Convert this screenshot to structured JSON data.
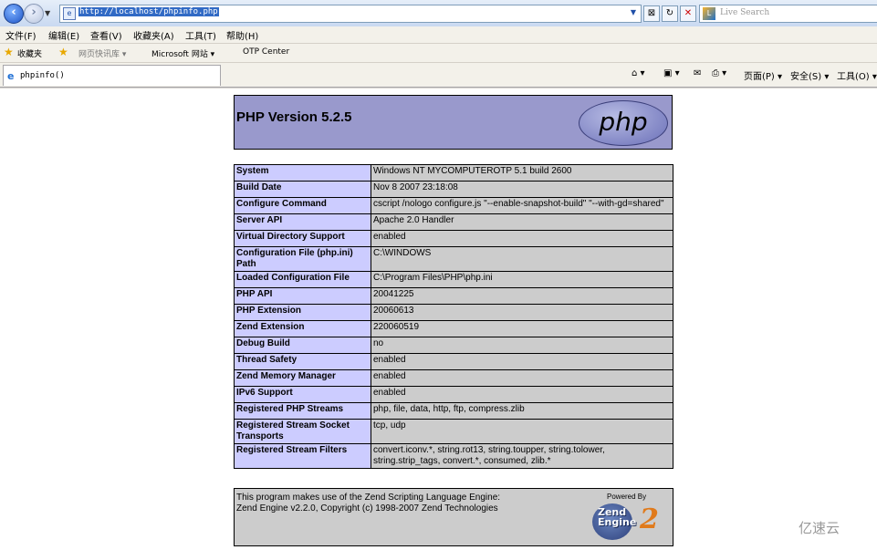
{
  "browser": {
    "address": "http://localhost/phpinfo.php",
    "search_placeholder": "Live Search",
    "menu": [
      "文件(F)",
      "编辑(E)",
      "查看(V)",
      "收藏夹(A)",
      "工具(T)",
      "帮助(H)"
    ],
    "favorites": {
      "label": "收藏夹",
      "items": [
        "网页快讯库 ▾",
        "Microsoft 网站 ▾",
        "OTP Center"
      ]
    },
    "tab_title": "phpinfo()",
    "commands": [
      "页面(P) ▾",
      "安全(S) ▾",
      "工具(O) ▾"
    ]
  },
  "page": {
    "title": "PHP Version 5.2.5",
    "logo_text": "php",
    "rows": [
      {
        "key": "System",
        "value": "Windows NT MYCOMPUTEROTP 5.1 build 2600"
      },
      {
        "key": "Build Date",
        "value": "Nov 8 2007 23:18:08"
      },
      {
        "key": "Configure Command",
        "value": "cscript /nologo configure.js \"--enable-snapshot-build\" \"--with-gd=shared\""
      },
      {
        "key": "Server API",
        "value": "Apache 2.0 Handler"
      },
      {
        "key": "Virtual Directory Support",
        "value": "enabled"
      },
      {
        "key": "Configuration File (php.ini) Path",
        "value": "C:\\WINDOWS"
      },
      {
        "key": "Loaded Configuration File",
        "value": "C:\\Program Files\\PHP\\php.ini"
      },
      {
        "key": "PHP API",
        "value": "20041225"
      },
      {
        "key": "PHP Extension",
        "value": "20060613"
      },
      {
        "key": "Zend Extension",
        "value": "220060519"
      },
      {
        "key": "Debug Build",
        "value": "no"
      },
      {
        "key": "Thread Safety",
        "value": "enabled"
      },
      {
        "key": "Zend Memory Manager",
        "value": "enabled"
      },
      {
        "key": "IPv6 Support",
        "value": "enabled"
      },
      {
        "key": "Registered PHP Streams",
        "value": "php, file, data, http, ftp, compress.zlib"
      },
      {
        "key": "Registered Stream Socket Transports",
        "value": "tcp, udp"
      },
      {
        "key": "Registered Stream Filters",
        "value": "convert.iconv.*, string.rot13, string.toupper, string.tolower, string.strip_tags, convert.*, consumed, zlib.*"
      }
    ],
    "footer_line1": "This program makes use of the Zend Scripting Language Engine:",
    "footer_line2": "Zend Engine v2.2.0, Copyright (c) 1998-2007 Zend Technologies",
    "zend_powered": "Powered By",
    "zend_word1": "Zend",
    "zend_word2": "Engine",
    "zend_two": "2"
  },
  "watermark": "亿速云"
}
